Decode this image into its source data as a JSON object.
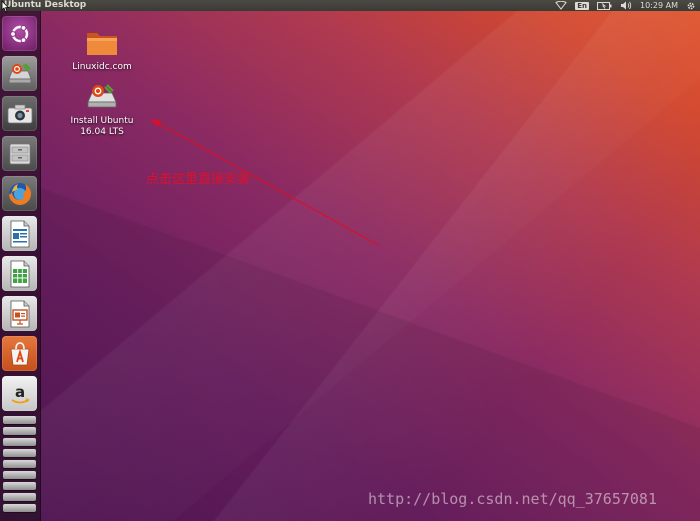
{
  "top_panel": {
    "title": "Ubuntu Desktop",
    "keyboard_layout": "En",
    "clock": "10:29 AM",
    "tray_icons": [
      "network-icon",
      "keyboard-layout-indicator",
      "battery-icon",
      "volume-icon",
      "settings-gear-icon"
    ]
  },
  "launcher": {
    "items": [
      {
        "name": "dash-home",
        "icon": "ubuntu-logo-icon"
      },
      {
        "name": "install-ubuntu",
        "icon": "installer-icon"
      },
      {
        "name": "cheese-webcam",
        "icon": "camera-icon"
      },
      {
        "name": "files",
        "icon": "file-cabinet-icon"
      },
      {
        "name": "firefox",
        "icon": "firefox-icon"
      },
      {
        "name": "libreoffice-writer",
        "icon": "writer-icon"
      },
      {
        "name": "libreoffice-calc",
        "icon": "calc-icon"
      },
      {
        "name": "libreoffice-impress",
        "icon": "impress-icon"
      },
      {
        "name": "ubuntu-software",
        "icon": "software-center-icon"
      },
      {
        "name": "amazon",
        "icon": "amazon-icon"
      }
    ]
  },
  "desktop": {
    "icons": [
      {
        "label_lines": [
          "Linuxidc.com"
        ],
        "icon": "folder-icon"
      },
      {
        "label_lines": [
          "Install Ubuntu",
          "16.04 LTS"
        ],
        "icon": "installer-icon"
      }
    ]
  },
  "annotation": {
    "text": "点击这里直接安装",
    "color": "#e0102a"
  },
  "watermark": "http://blog.csdn.net/qq_37657081",
  "colors": {
    "panel": "#3b3a36",
    "wallpaper_purple": "#5e1f5b",
    "wallpaper_orange": "#e0532a"
  }
}
